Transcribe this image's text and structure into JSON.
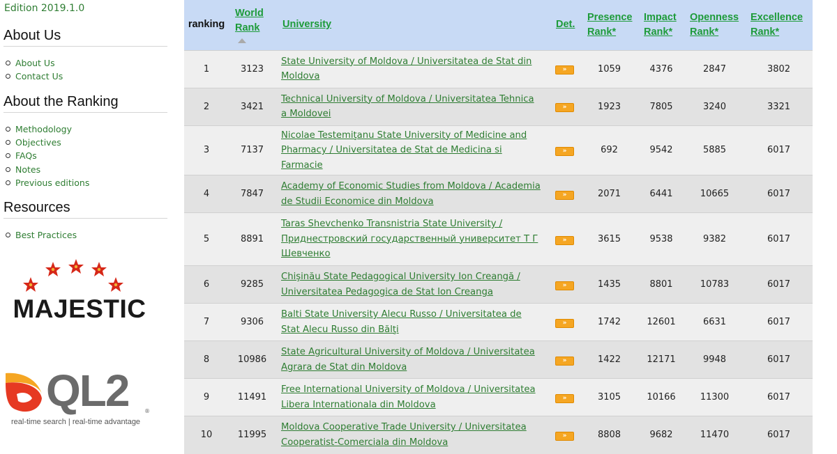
{
  "edition": "Edition 2019.1.0",
  "sidebar": {
    "about_us": {
      "title": "About Us",
      "items": [
        "About Us",
        "Contact Us"
      ]
    },
    "about_ranking": {
      "title": "About the Ranking",
      "items": [
        "Methodology",
        "Objectives",
        "FAQs",
        "Notes",
        "Previous editions"
      ]
    },
    "resources": {
      "title": "Resources",
      "items": [
        "Best Practices"
      ]
    }
  },
  "logos": {
    "majestic": "MAJESTIC",
    "ql2": "QL2",
    "ql2_registered": "®",
    "ql2_tagline": "real-time search | real-time advantage"
  },
  "table": {
    "headers": {
      "ranking": "ranking",
      "world_rank_1": "World",
      "world_rank_2": "Rank",
      "university": "University",
      "det": "Det.",
      "presence_1": "Presence",
      "presence_2": "Rank*",
      "impact_1": "Impact",
      "impact_2": "Rank*",
      "openness_1": "Openness",
      "openness_2": "Rank*",
      "excellence_1": "Excellence",
      "excellence_2": "Rank*"
    },
    "det_icon_text": "»",
    "rows": [
      {
        "ranking": "1",
        "world_rank": "3123",
        "university": "State University of Moldova / Universitatea de Stat din Moldova",
        "presence": "1059",
        "impact": "4376",
        "openness": "2847",
        "excellence": "3802"
      },
      {
        "ranking": "2",
        "world_rank": "3421",
        "university": "Technical University of Moldova / Universitatea Tehnica a Moldovei",
        "presence": "1923",
        "impact": "7805",
        "openness": "3240",
        "excellence": "3321"
      },
      {
        "ranking": "3",
        "world_rank": "7137",
        "university": "Nicolae Testemiţanu State University of Medicine and Pharmacy / Universitatea de Stat de Medicina si Farmacie",
        "presence": "692",
        "impact": "9542",
        "openness": "5885",
        "excellence": "6017"
      },
      {
        "ranking": "4",
        "world_rank": "7847",
        "university": "Academy of Economic Studies from Moldova / Academia de Studii Economice din Moldova",
        "presence": "2071",
        "impact": "6441",
        "openness": "10665",
        "excellence": "6017"
      },
      {
        "ranking": "5",
        "world_rank": "8891",
        "university": "Taras Shevchenko Transnistria State University / Приднестровский государственный университет Т Г Шевченко",
        "presence": "3615",
        "impact": "9538",
        "openness": "9382",
        "excellence": "6017"
      },
      {
        "ranking": "6",
        "world_rank": "9285",
        "university": "Chişinău State Pedagogical University Ion Creangă / Universitatea Pedagogica de Stat Ion Creanga",
        "presence": "1435",
        "impact": "8801",
        "openness": "10783",
        "excellence": "6017"
      },
      {
        "ranking": "7",
        "world_rank": "9306",
        "university": "Balti State University Alecu Russo / Universitatea de Stat Alecu Russo din Bălţi",
        "presence": "1742",
        "impact": "12601",
        "openness": "6631",
        "excellence": "6017"
      },
      {
        "ranking": "8",
        "world_rank": "10986",
        "university": "State Agricultural University of Moldova / Universitatea Agrara de Stat din Moldova",
        "presence": "1422",
        "impact": "12171",
        "openness": "9948",
        "excellence": "6017"
      },
      {
        "ranking": "9",
        "world_rank": "11491",
        "university": "Free International University of Moldova / Universitatea Libera Internationala din Moldova",
        "presence": "3105",
        "impact": "10166",
        "openness": "11300",
        "excellence": "6017"
      },
      {
        "ranking": "10",
        "world_rank": "11995",
        "university": "Moldova Cooperative Trade University / Universitatea Cooperatist-Comerciala din Moldova",
        "presence": "8808",
        "impact": "9682",
        "openness": "11470",
        "excellence": "6017"
      }
    ]
  }
}
